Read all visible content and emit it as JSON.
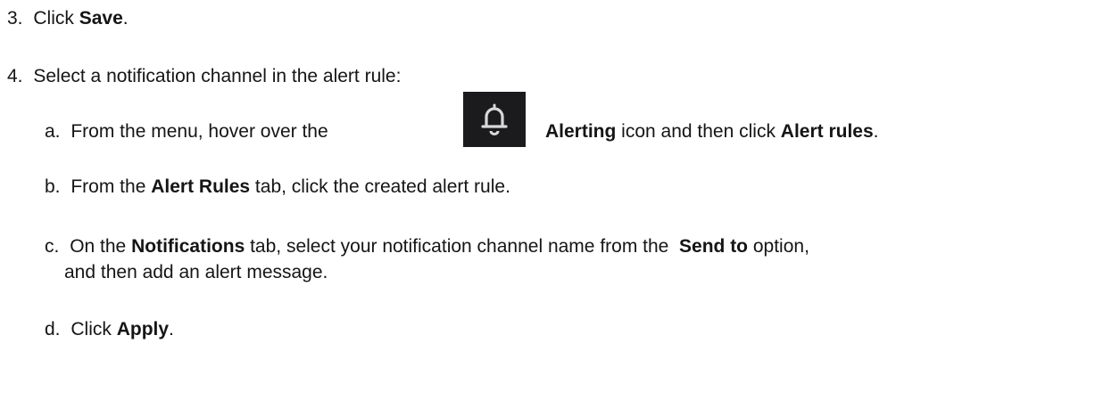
{
  "steps": {
    "s3": {
      "num": "3.",
      "pre": "Click ",
      "bold": "Save",
      "post": "."
    },
    "s4": {
      "num": "4.",
      "text": "Select a notification channel in the alert rule:"
    },
    "a": {
      "num": "a.",
      "pre": "From the menu, hover over the",
      "icon": "bell-icon",
      "bold1": "Alerting",
      "mid": " icon and then click ",
      "bold2": "Alert rules",
      "post": "."
    },
    "b": {
      "num": "b.",
      "pre": "From the ",
      "bold": "Alert Rules",
      "post": " tab, click the created alert rule."
    },
    "c": {
      "num": "c.",
      "pre": "On the ",
      "bold1": "Notifications",
      "mid": " tab, select your notification channel name from the  ",
      "bold2": "Send to",
      "post": " option,",
      "line2": "and then add an alert message."
    },
    "d": {
      "num": "d.",
      "pre": "Click ",
      "bold": "Apply",
      "post": "."
    }
  },
  "colors": {
    "text": "#151515",
    "icon_bg": "#1b1b1d",
    "icon_fg": "#d8d8d8"
  }
}
